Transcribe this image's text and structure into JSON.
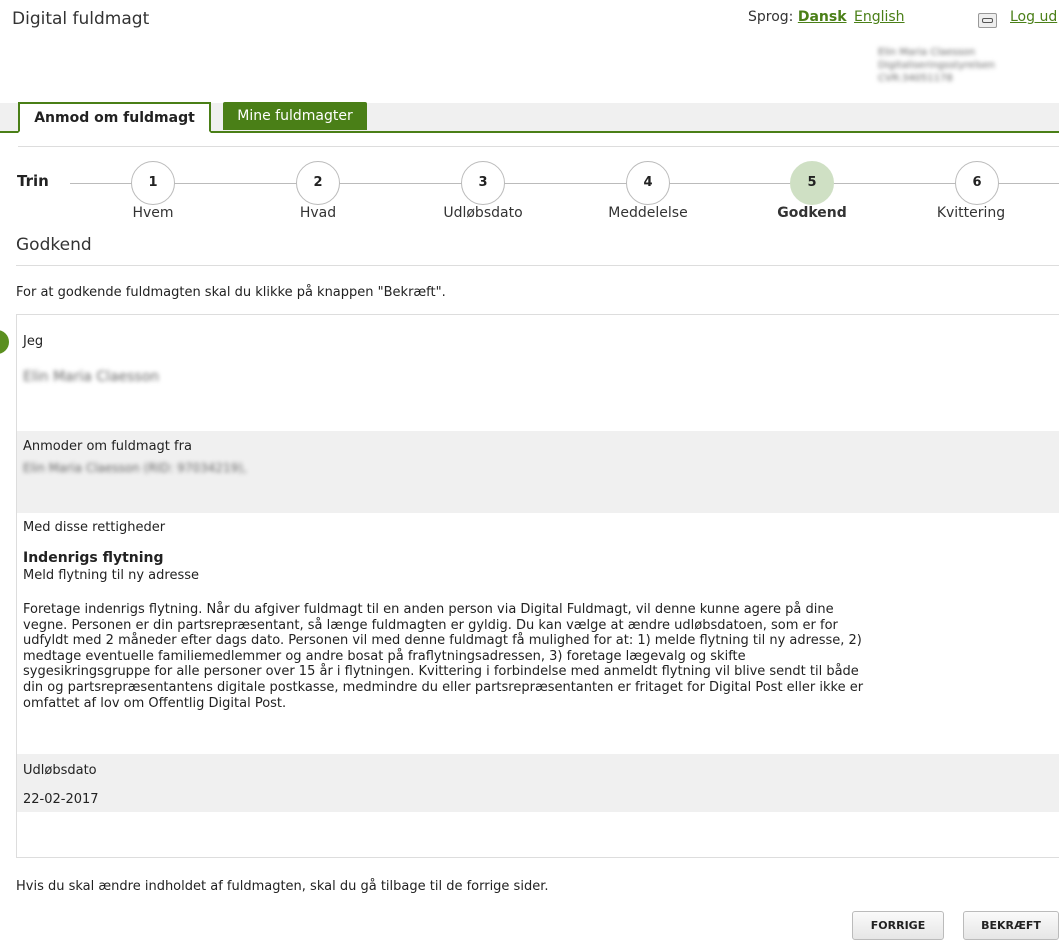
{
  "header": {
    "app_title": "Digital fuldmagt",
    "language_label": "Sprog:",
    "language_current": "Dansk",
    "language_other": "English",
    "logout_label": "Log ud",
    "logout_icon": "key-icon",
    "user_name": "Elin Maria Claesson",
    "user_org": "Digitaliseringsstyrelsen",
    "user_cvr": "CVR:34051178"
  },
  "tabs": [
    {
      "label": "Anmod om fuldmagt",
      "active": true
    },
    {
      "label": "Mine fuldmagter",
      "active": false
    }
  ],
  "steps": {
    "label": "Trin",
    "items": [
      {
        "number": "1",
        "label": "Hvem"
      },
      {
        "number": "2",
        "label": "Hvad"
      },
      {
        "number": "3",
        "label": "Udløbsdato"
      },
      {
        "number": "4",
        "label": "Meddelelse"
      },
      {
        "number": "5",
        "label": "Godkend",
        "active": true
      },
      {
        "number": "6",
        "label": "Kvittering"
      }
    ]
  },
  "section": {
    "heading": "Godkend",
    "instruction": "For at godkende fuldmagten skal du klikke på knappen \"Bekræft\"."
  },
  "summary": {
    "jeg_label": "Jeg",
    "jeg_value": "Elin Maria Claesson",
    "from_label": "Anmoder om fuldmagt fra",
    "from_value": "Elin Maria Claesson (RID: 97034219),",
    "rights_label": "Med disse rettigheder",
    "right_title": "Indenrigs flytning",
    "right_subtitle": "Meld flytning til ny adresse",
    "right_description": "Foretage indenrigs flytning. Når du afgiver fuldmagt til en anden person via Digital Fuldmagt, vil denne kunne agere på dine vegne. Personen er din partsrepræsentant, så længe fuldmagten er gyldig. Du kan vælge at ændre udløbsdatoen, som er for udfyldt med 2 måneder efter dags dato. Personen vil med denne fuldmagt få mulighed for at: 1) melde flytning til ny adresse, 2) medtage eventuelle familiemedlemmer og andre bosat på fraflytningsadressen, 3) foretage lægevalg og skifte sygesikringsgruppe for alle personer over 15 år i flytningen. Kvittering i forbindelse med anmeldt flytning vil blive sendt til både din og partsrepræsentantens digitale postkasse, medmindre du eller partsrepræsentanten er fritaget for Digital Post eller ikke er omfattet af lov om Offentlig Digital Post.",
    "expiry_label": "Udløbsdato",
    "expiry_value": "22-02-2017"
  },
  "footer": {
    "note": "Hvis du skal ændre indholdet af fuldmagten, skal du gå tilbage til de forrige sider.",
    "prev_button": "FORRIGE",
    "confirm_button": "BEKRÆFT"
  },
  "colors": {
    "accent": "#4a7f17",
    "active_step": "#cfe0c4",
    "row_bg": "#f0f0f0"
  }
}
